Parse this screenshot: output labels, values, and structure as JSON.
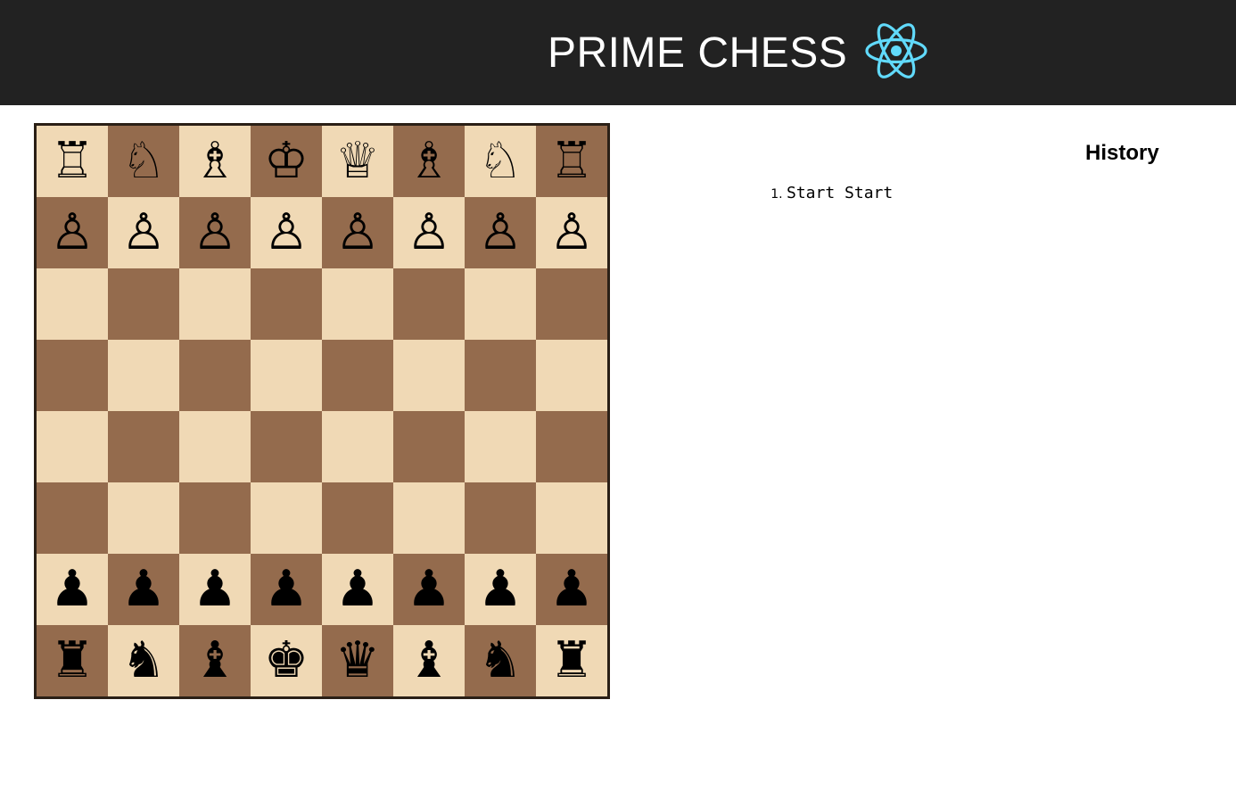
{
  "header": {
    "title": "PRIME CHESS",
    "logo_icon": "react-atom-icon",
    "logo_color": "#61dafb",
    "background": "#222222"
  },
  "board": {
    "light_color": "#f0d9b5",
    "dark_color": "#946b4d",
    "ranks": [
      [
        "♖",
        "♘",
        "♗",
        "♔",
        "♕",
        "♗",
        "♘",
        "♖"
      ],
      [
        "♙",
        "♙",
        "♙",
        "♙",
        "♙",
        "♙",
        "♙",
        "♙"
      ],
      [
        "",
        "",
        "",
        "",
        "",
        "",
        "",
        ""
      ],
      [
        "",
        "",
        "",
        "",
        "",
        "",
        "",
        ""
      ],
      [
        "",
        "",
        "",
        "",
        "",
        "",
        "",
        ""
      ],
      [
        "",
        "",
        "",
        "",
        "",
        "",
        "",
        ""
      ],
      [
        "♟",
        "♟",
        "♟",
        "♟",
        "♟",
        "♟",
        "♟",
        "♟"
      ],
      [
        "♜",
        "♞",
        "♝",
        "♚",
        "♛",
        "♝",
        "♞",
        "♜"
      ]
    ]
  },
  "history": {
    "title": "History",
    "moves": [
      "Start Start"
    ]
  }
}
